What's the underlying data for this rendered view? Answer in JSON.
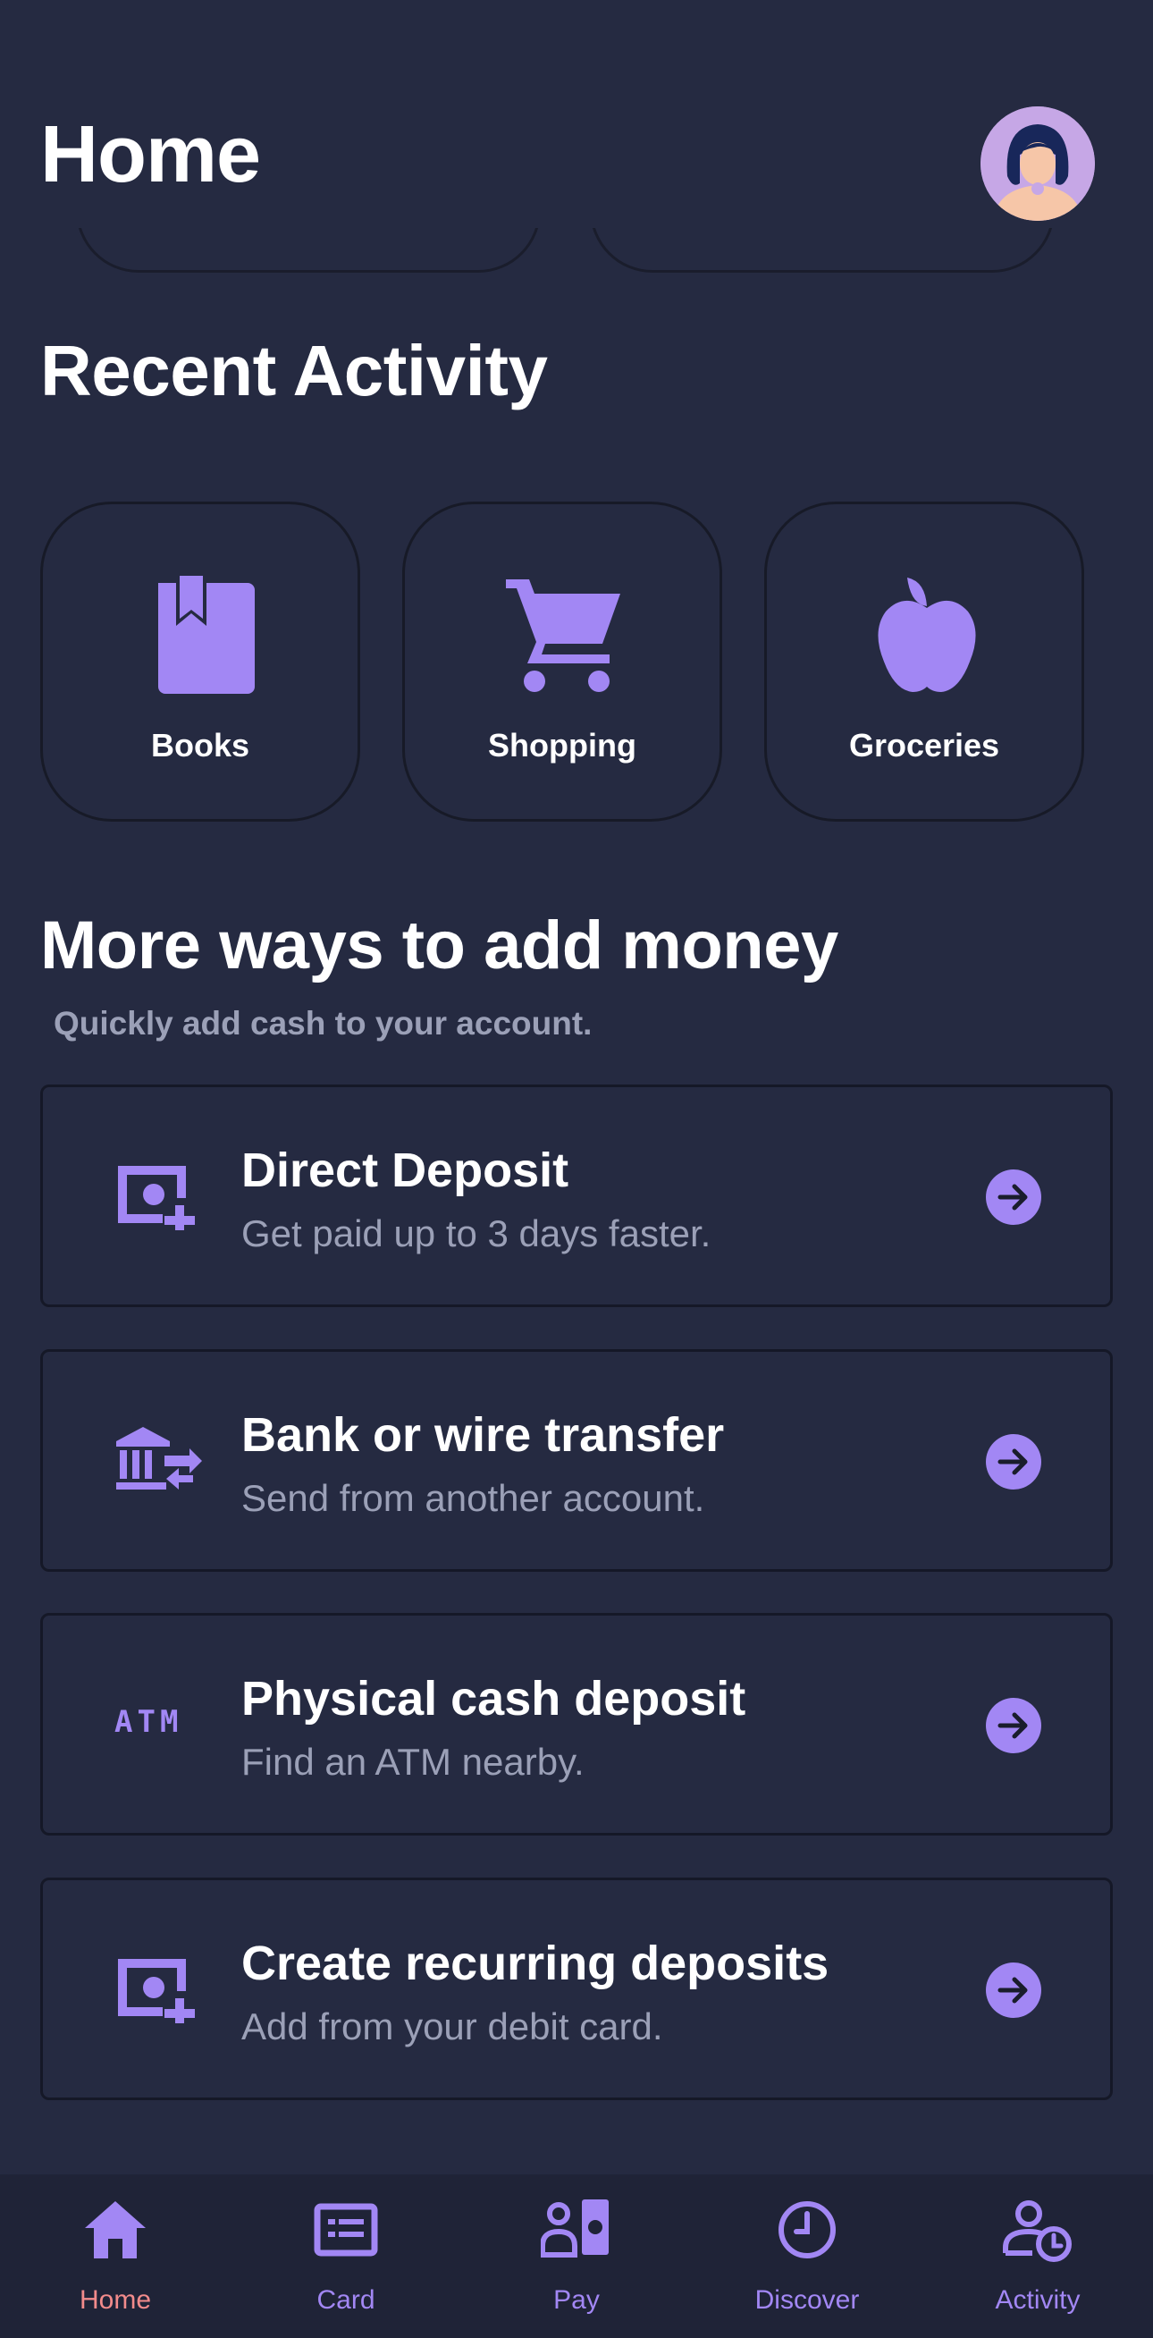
{
  "header": {
    "title": "Home"
  },
  "recent_activity": {
    "title": "Recent Activity",
    "tiles": [
      {
        "label": "Books",
        "icon": "book-icon"
      },
      {
        "label": "Shopping",
        "icon": "cart-icon"
      },
      {
        "label": "Groceries",
        "icon": "apple-icon"
      }
    ]
  },
  "add_money": {
    "title": "More ways to add money",
    "subtitle": "Quickly add cash to your account.",
    "options": [
      {
        "title": "Direct Deposit",
        "description": "Get paid up to 3 days faster.",
        "icon": "cash-plus-icon"
      },
      {
        "title": "Bank or wire transfer",
        "description": "Send from another account.",
        "icon": "bank-transfer-icon"
      },
      {
        "title": "Physical cash deposit",
        "description": "Find an ATM nearby.",
        "icon": "atm-icon",
        "icon_text": "ATM"
      },
      {
        "title": "Create recurring deposits",
        "description": "Add from your debit card.",
        "icon": "cash-plus-icon"
      }
    ]
  },
  "tabbar": {
    "tabs": [
      {
        "label": "Home",
        "icon": "home-icon",
        "active": true
      },
      {
        "label": "Card",
        "icon": "card-icon",
        "active": false
      },
      {
        "label": "Pay",
        "icon": "pay-icon",
        "active": false
      },
      {
        "label": "Discover",
        "icon": "clock-icon",
        "active": false
      },
      {
        "label": "Activity",
        "icon": "user-clock-icon",
        "active": false
      }
    ]
  },
  "colors": {
    "background": "#252a41",
    "accent": "#a287f4",
    "active_tab": "#f28b8b",
    "tabbar_bg": "#1f2337",
    "muted_text": "#9ba0b7"
  }
}
